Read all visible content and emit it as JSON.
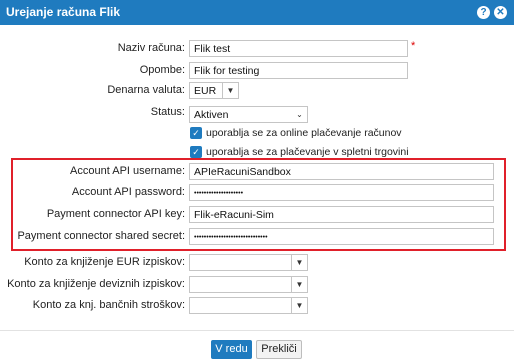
{
  "dialog": {
    "title": "Urejanje računa Flik",
    "help_icon": "help-icon",
    "close_icon": "close-icon"
  },
  "form": {
    "name": {
      "label": "Naziv računa:",
      "value": "Flik test",
      "required_mark": "*"
    },
    "notes": {
      "label": "Opombe:",
      "value": "Flik for testing"
    },
    "currency": {
      "label": "Denarna valuta:",
      "value": "EUR"
    },
    "status": {
      "label": "Status:",
      "value": "Aktiven"
    },
    "checkbox_online": {
      "label": "uporablja se za online plačevanje računov",
      "checked": true
    },
    "checkbox_shop": {
      "label": "uporablja se za plačevanje v spletni trgovini",
      "checked": true
    },
    "api_username": {
      "label": "Account API username:",
      "value": "APIeRacuniSandbox"
    },
    "api_password": {
      "label": "Account API password:",
      "value": "••••••••••••••••••••"
    },
    "connector_key": {
      "label": "Payment connector API key:",
      "value": "Flik-eRacuni-Sim"
    },
    "connector_secret": {
      "label": "Payment connector shared secret:",
      "value": "••••••••••••••••••••••••••••••"
    },
    "konto_eur": {
      "label": "Konto za knjiženje EUR izpiskov:",
      "value": ""
    },
    "konto_deviz": {
      "label": "Konto za knjiženje deviznih izpiskov:",
      "value": ""
    },
    "konto_stroski": {
      "label": "Konto za knj. bančnih stroškov:",
      "value": ""
    }
  },
  "footer": {
    "ok_label": "V redu",
    "cancel_label": "Prekliči"
  },
  "colors": {
    "accent": "#1f7bbf",
    "highlight_border": "#e0202a"
  }
}
